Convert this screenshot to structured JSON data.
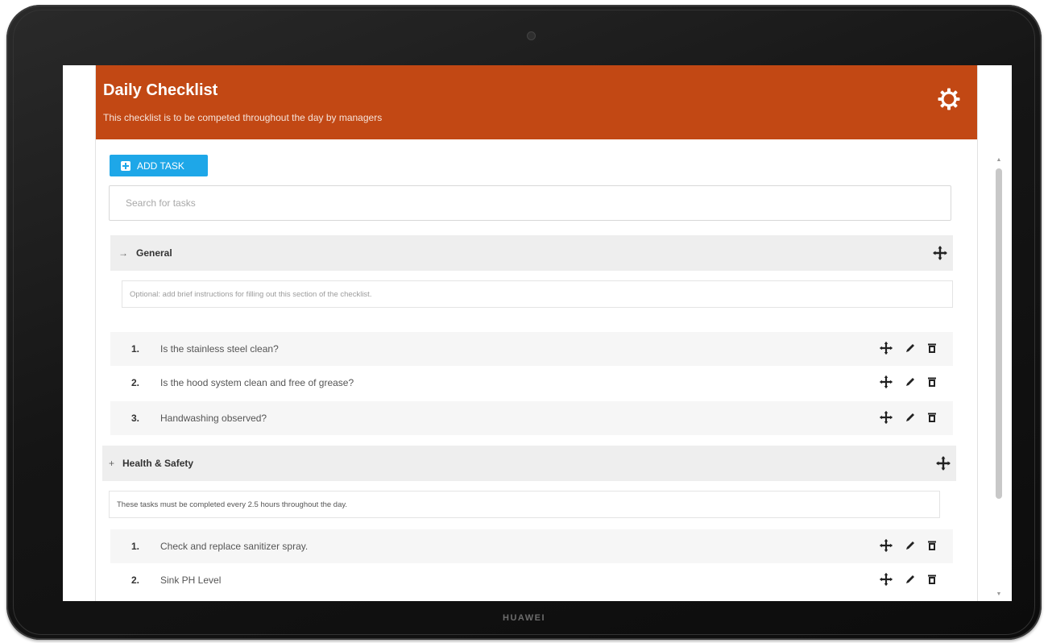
{
  "device": {
    "brand": "HUAWEI"
  },
  "header": {
    "title": "Daily Checklist",
    "subtitle": "This checklist is to be competed throughout the day by managers",
    "bg_color": "#c24814"
  },
  "toolbar": {
    "add_task_label": "ADD TASK",
    "accent": "#1ea7e8"
  },
  "search": {
    "placeholder": "Search for tasks"
  },
  "sections": [
    {
      "name": "General",
      "toggle": "→",
      "note": "Optional: add brief instructions for filling out this section of the checklist.",
      "tasks": [
        {
          "num": "1.",
          "text": "Is the stainless steel clean?"
        },
        {
          "num": "2.",
          "text": "Is the hood system clean and free of grease?"
        },
        {
          "num": "3.",
          "text": "Handwashing observed?"
        }
      ]
    },
    {
      "name": "Health & Safety",
      "toggle": "+",
      "note": "These tasks must be completed every 2.5 hours throughout the day.",
      "tasks": [
        {
          "num": "1.",
          "text": "Check and replace sanitizer spray."
        },
        {
          "num": "2.",
          "text": "Sink PH Level"
        }
      ]
    }
  ],
  "icons": {
    "settings": "gear-icon",
    "add_section_item": "move-plus-icon",
    "edit": "pencil-icon",
    "delete": "trash-icon"
  }
}
